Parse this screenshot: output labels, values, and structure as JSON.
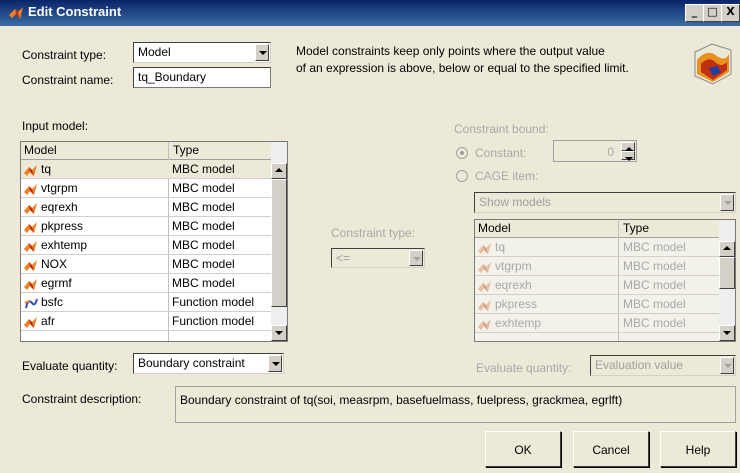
{
  "window": {
    "title": "Edit Constraint",
    "minimize": "_",
    "maximize": "□",
    "close": "X"
  },
  "constraint_type": {
    "label": "Constraint type:",
    "value": "Model"
  },
  "constraint_name": {
    "label": "Constraint name:",
    "value": "tq_Boundary"
  },
  "info_text": [
    "Model constraints keep only points where the output value",
    "of an expression is above, below or equal to the specified limit."
  ],
  "input_model": {
    "label": "Input model:",
    "columns": [
      "Model",
      "Type"
    ],
    "rows": [
      {
        "name": "tq",
        "type": "MBC model",
        "icon": "mbc-model-icon"
      },
      {
        "name": "vtgrpm",
        "type": "MBC model",
        "icon": "mbc-model-icon"
      },
      {
        "name": "eqrexh",
        "type": "MBC model",
        "icon": "mbc-model-icon"
      },
      {
        "name": "pkpress",
        "type": "MBC model",
        "icon": "mbc-model-icon"
      },
      {
        "name": "exhtemp",
        "type": "MBC model",
        "icon": "mbc-model-icon"
      },
      {
        "name": "NOX",
        "type": "MBC model",
        "icon": "mbc-model-icon"
      },
      {
        "name": "egrmf",
        "type": "MBC model",
        "icon": "mbc-model-icon"
      },
      {
        "name": "bsfc",
        "type": "Function model",
        "icon": "function-model-icon"
      },
      {
        "name": "afr",
        "type": "Function model",
        "icon": "mbc-model-icon"
      }
    ]
  },
  "evaluate_quantity_left": {
    "label": "Evaluate quantity:",
    "value": "Boundary constraint"
  },
  "middle": {
    "label": "Constraint type:",
    "value": "<="
  },
  "constraint_bound": {
    "label": "Constraint bound:",
    "constant_label": "Constant:",
    "constant_value": "0",
    "cage_label": "CAGE item:",
    "show_models": "Show models",
    "columns": [
      "Model",
      "Type"
    ],
    "rows": [
      {
        "name": "tq",
        "type": "MBC model"
      },
      {
        "name": "vtgrpm",
        "type": "MBC model"
      },
      {
        "name": "eqrexh",
        "type": "MBC model"
      },
      {
        "name": "pkpress",
        "type": "MBC model"
      },
      {
        "name": "exhtemp",
        "type": "MBC model"
      }
    ]
  },
  "evaluate_quantity_right": {
    "label": "Evaluate quantity:",
    "value": "Evaluation value"
  },
  "description": {
    "label": "Constraint description:",
    "value": "Boundary constraint of tq(soi, measrpm, basefuelmass, fuelpress, grackmea, egrlft)"
  },
  "buttons": {
    "ok": "OK",
    "cancel": "Cancel",
    "help": "Help"
  }
}
